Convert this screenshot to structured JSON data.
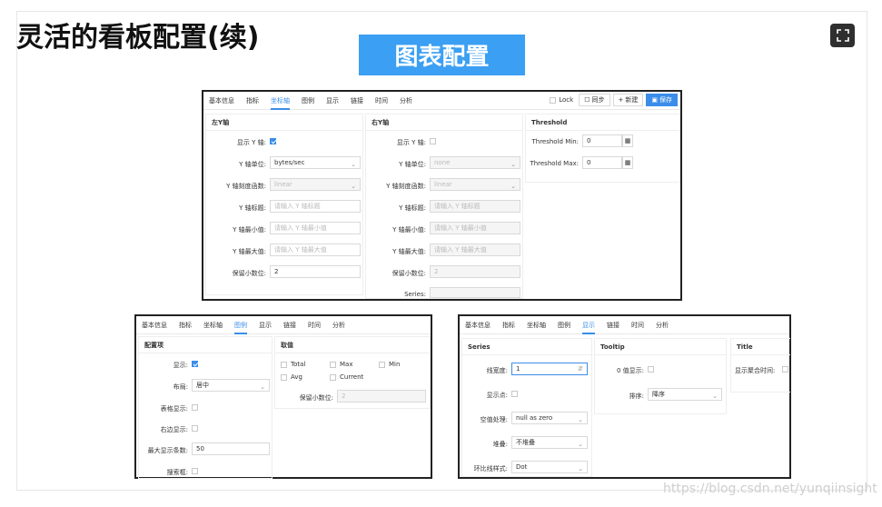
{
  "slide": {
    "title": "灵活的看板配置(续)",
    "banner": "图表配置",
    "watermark": "https://blog.csdn.net/yunqiinsight"
  },
  "colors": {
    "accent": "#3b8de9",
    "banner": "#3b9ff3"
  },
  "main": {
    "tabs": [
      "基本信息",
      "指标",
      "坐标轴",
      "图例",
      "显示",
      "链接",
      "时间",
      "分析"
    ],
    "active_tab": "坐标轴",
    "toolbar": {
      "lock": "Lock",
      "sync": "同步",
      "new": "新建",
      "save": "保存"
    },
    "left_axis": {
      "header": "左Y轴",
      "show_label": "显示 Y 轴:",
      "unit_label": "Y 轴单位:",
      "unit_value": "bytes/sec",
      "scale_label": "Y 轴刻度函数:",
      "scale_value": "linear",
      "title_label": "Y 轴标题:",
      "title_ph": "请输入 Y 轴标题",
      "min_label": "Y 轴最小值:",
      "min_ph": "请输入 Y 轴最小值",
      "max_label": "Y 轴最大值:",
      "max_ph": "请输入 Y 轴最大值",
      "dec_label": "保留小数位:",
      "dec_value": "2"
    },
    "right_axis": {
      "header": "右Y轴",
      "show_label": "显示 Y 轴:",
      "unit_label": "Y 轴单位:",
      "unit_value": "none",
      "scale_label": "Y 轴刻度函数:",
      "scale_value": "linear",
      "title_label": "Y 轴标题:",
      "title_ph": "请输入 Y 轴标题",
      "min_label": "Y 轴最小值:",
      "min_ph": "请输入 Y 轴最小值",
      "max_label": "Y 轴最大值:",
      "max_ph": "请输入 Y 轴最大值",
      "dec_label": "保留小数位:",
      "dec_value": "2",
      "series_label": "Series:"
    },
    "threshold": {
      "header": "Threshold",
      "min_label": "Threshold Min:",
      "min_value": "0",
      "max_label": "Threshold Max:",
      "max_value": "0"
    }
  },
  "legend_panel": {
    "tabs": [
      "基本信息",
      "指标",
      "坐标轴",
      "图例",
      "显示",
      "链接",
      "时间",
      "分析"
    ],
    "active_tab": "图例",
    "config": {
      "header": "配置项",
      "show_label": "显示:",
      "layout_label": "布局:",
      "layout_value": "居中",
      "table_label": "表格显示:",
      "right_label": "右边显示:",
      "max_label": "最大显示条数:",
      "max_value": "50",
      "search_label": "搜索框:"
    },
    "values": {
      "header": "取值",
      "options": [
        "Total",
        "Max",
        "Min",
        "Avg",
        "Current"
      ],
      "dec_label": "保留小数位:",
      "dec_value": "2"
    }
  },
  "display_panel": {
    "tabs": [
      "基本信息",
      "指标",
      "坐标轴",
      "图例",
      "显示",
      "链接",
      "时间",
      "分析"
    ],
    "active_tab": "显示",
    "series": {
      "header": "Series",
      "width_label": "线宽度:",
      "width_value": "1",
      "points_label": "显示点:",
      "null_label": "空值处理:",
      "null_value": "null as zero",
      "stack_label": "堆叠:",
      "stack_value": "不堆叠",
      "ring_label": "环比线样式:",
      "ring_value": "Dot"
    },
    "tooltip": {
      "header": "Tooltip",
      "zero_label": "0 值显示:",
      "sort_label": "排序:",
      "sort_value": "降序"
    },
    "title": {
      "header": "Title",
      "agg_label": "显示聚合时间:"
    }
  }
}
